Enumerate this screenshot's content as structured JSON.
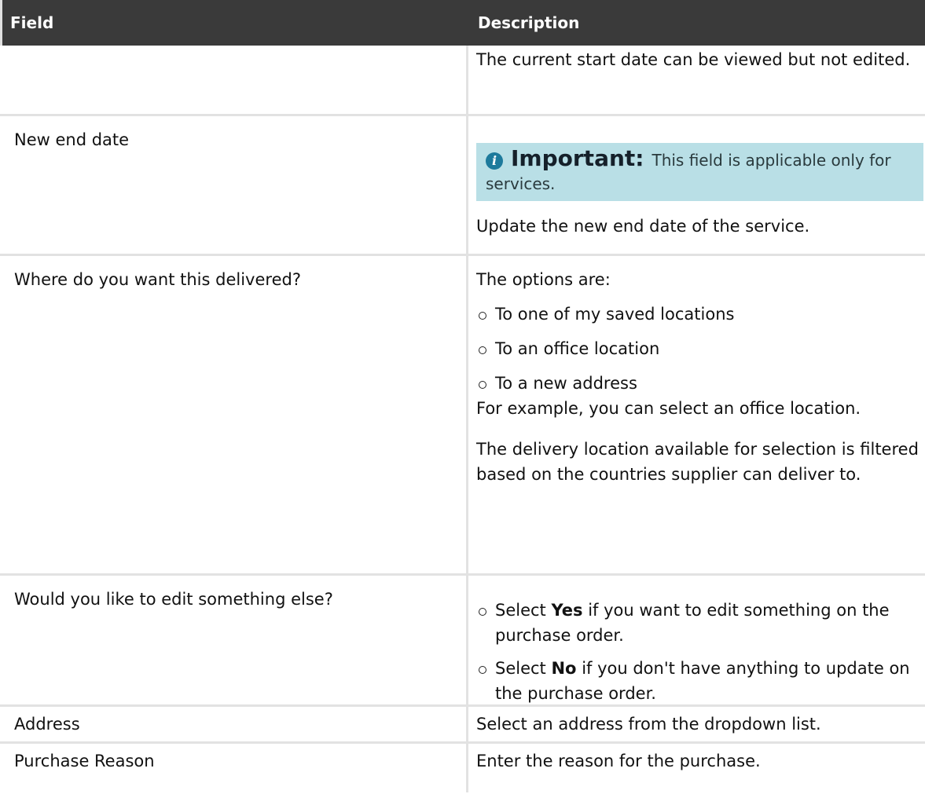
{
  "header": {
    "field": "Field",
    "description": "Description"
  },
  "rows": [
    {
      "field": "",
      "description": "The current start date can be viewed but not edited."
    },
    {
      "field": "New end date",
      "note": {
        "label": "Important:",
        "text": "This field is applicable only for services."
      },
      "description": "Update the new end date of the service."
    },
    {
      "field": "Where do you want this delivered?",
      "intro": "The options are:",
      "options": [
        "To one of my saved locations",
        "To an office location",
        "To a new address"
      ],
      "example": "For example, you can select an office location.",
      "extra": "The delivery location available for selection is filtered based on the countries supplier can deliver to."
    },
    {
      "field": "Would you like to edit something else?",
      "options": [
        {
          "prefix": "Select",
          "strong": "Yes",
          "suffix": "if you want to edit something on the purchase order."
        },
        {
          "prefix": "Select",
          "strong": "No",
          "suffix": "if you don't have anything to update on the purchase order."
        }
      ]
    },
    {
      "field": "Address",
      "description": "Select an address from the dropdown list."
    },
    {
      "field": "Purchase Reason",
      "description": "Enter the reason for the purchase."
    }
  ]
}
